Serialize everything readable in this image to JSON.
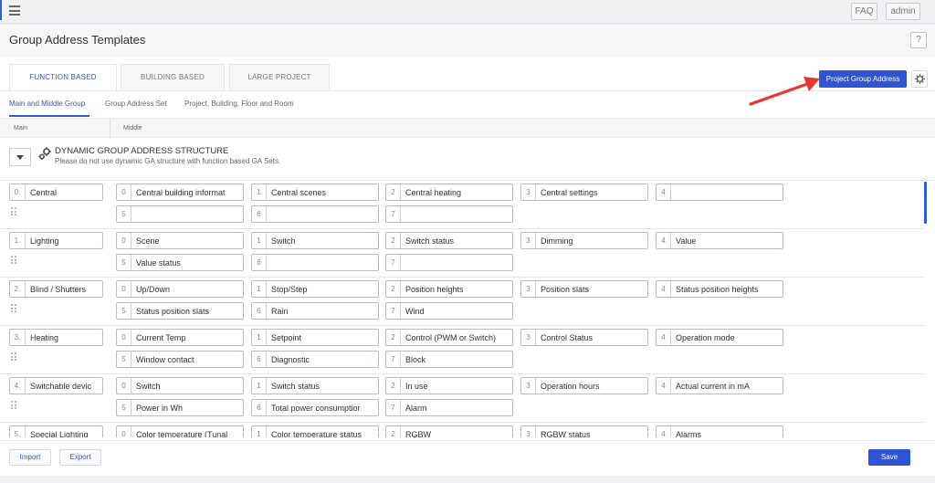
{
  "topbar": {
    "faq": "FAQ",
    "admin": "admin"
  },
  "header": {
    "title": "Group Address Templates",
    "help": "?"
  },
  "tabs": [
    {
      "label": "FUNCTION BASED"
    },
    {
      "label": "BUILDING BASED"
    },
    {
      "label": "LARGE PROJECT"
    }
  ],
  "project_button": "Project Group Address",
  "subtabs": [
    {
      "label": "Main and Middle Group"
    },
    {
      "label": "Group Address Set"
    },
    {
      "label": "Project, Building, Floor and Room"
    }
  ],
  "columns": {
    "main": "Main",
    "middle": "Middle"
  },
  "dynamic": {
    "title": "DYNAMIC GROUP ADDRESS STRUCTURE",
    "subtitle": "Please do not use dynamic GA structure with function based GA Sets."
  },
  "groups": [
    {
      "num": "0.",
      "name": "Central",
      "middles": [
        {
          "num": "0",
          "name": "Central building informat"
        },
        {
          "num": "1",
          "name": "Central scenes"
        },
        {
          "num": "2",
          "name": "Central heating"
        },
        {
          "num": "3",
          "name": "Central settings"
        },
        {
          "num": "4",
          "name": ""
        },
        {
          "num": "5",
          "name": ""
        },
        {
          "num": "6",
          "name": ""
        },
        {
          "num": "7",
          "name": ""
        }
      ]
    },
    {
      "num": "1.",
      "name": "Lighting",
      "middles": [
        {
          "num": "0",
          "name": "Scene"
        },
        {
          "num": "1",
          "name": "Switch"
        },
        {
          "num": "2",
          "name": "Switch status"
        },
        {
          "num": "3",
          "name": "Dimming"
        },
        {
          "num": "4",
          "name": "Value"
        },
        {
          "num": "5",
          "name": "Value status"
        },
        {
          "num": "6",
          "name": ""
        },
        {
          "num": "7",
          "name": ""
        }
      ]
    },
    {
      "num": "2.",
      "name": "Blind / Shutters",
      "middles": [
        {
          "num": "0",
          "name": "Up/Down"
        },
        {
          "num": "1",
          "name": "Stop/Step"
        },
        {
          "num": "2",
          "name": "Position heights"
        },
        {
          "num": "3",
          "name": "Position slats"
        },
        {
          "num": "4",
          "name": "Status position heights"
        },
        {
          "num": "5",
          "name": "Status position slats"
        },
        {
          "num": "6",
          "name": "Rain"
        },
        {
          "num": "7",
          "name": "Wind"
        }
      ]
    },
    {
      "num": "3.",
      "name": "Heating",
      "middles": [
        {
          "num": "0",
          "name": "Current Temp"
        },
        {
          "num": "1",
          "name": "Setpoint"
        },
        {
          "num": "2",
          "name": "Control (PWM or Switch)"
        },
        {
          "num": "3",
          "name": "Control Status"
        },
        {
          "num": "4",
          "name": "Operation mode"
        },
        {
          "num": "5",
          "name": "Window contact"
        },
        {
          "num": "6",
          "name": "Diagnostic"
        },
        {
          "num": "7",
          "name": "Block"
        }
      ]
    },
    {
      "num": "4.",
      "name": "Switchable devic",
      "middles": [
        {
          "num": "0",
          "name": "Switch"
        },
        {
          "num": "1",
          "name": "Switch status"
        },
        {
          "num": "2",
          "name": "In use"
        },
        {
          "num": "3",
          "name": "Operation hours"
        },
        {
          "num": "4",
          "name": "Actual current in mA"
        },
        {
          "num": "5",
          "name": "Power in Wh"
        },
        {
          "num": "6",
          "name": "Total power consumptior"
        },
        {
          "num": "7",
          "name": "Alarm"
        }
      ]
    },
    {
      "num": "5.",
      "name": "Special Lighting",
      "middles": [
        {
          "num": "0",
          "name": "Color temperature (Tunal"
        },
        {
          "num": "1",
          "name": "Color temperature status"
        },
        {
          "num": "2",
          "name": "RGBW"
        },
        {
          "num": "3",
          "name": "RGBW status"
        },
        {
          "num": "4",
          "name": "Alarms"
        }
      ]
    }
  ],
  "footer": {
    "import": "Import",
    "export": "Export",
    "save": "Save"
  },
  "colors": {
    "accent": "#2f55d4",
    "arrow": "#e53935"
  }
}
